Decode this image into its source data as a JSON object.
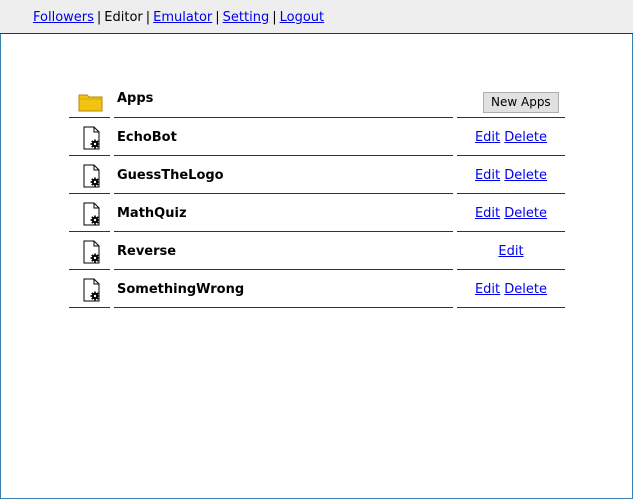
{
  "nav": {
    "items": [
      {
        "label": "Followers",
        "link": true
      },
      {
        "label": "Editor",
        "link": false
      },
      {
        "label": "Emulator",
        "link": true
      },
      {
        "label": "Setting",
        "link": true
      },
      {
        "label": "Logout",
        "link": true
      }
    ],
    "separator": "|"
  },
  "header": {
    "title": "Apps",
    "new_button": "New Apps",
    "icon": "folder-icon",
    "icon_color": "#f1c40f"
  },
  "apps": [
    {
      "name": "EchoBot",
      "edit": "Edit",
      "delete": "Delete"
    },
    {
      "name": "GuessTheLogo",
      "edit": "Edit",
      "delete": "Delete"
    },
    {
      "name": "MathQuiz",
      "edit": "Edit",
      "delete": "Delete"
    },
    {
      "name": "Reverse",
      "edit": "Edit",
      "delete": null
    },
    {
      "name": "SomethingWrong",
      "edit": "Edit",
      "delete": "Delete"
    }
  ],
  "colors": {
    "link": "#0000ee",
    "nav_bg": "#eeeeee",
    "frame": "#3c7fb1"
  }
}
